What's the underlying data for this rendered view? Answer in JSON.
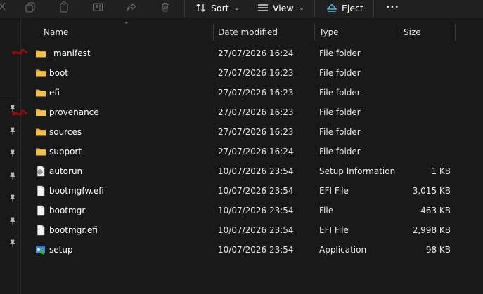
{
  "toolbar": {
    "sort_label": "Sort",
    "view_label": "View",
    "eject_label": "Eject",
    "more_label": "•••"
  },
  "columns": {
    "name": "Name",
    "date": "Date modified",
    "type": "Type",
    "size": "Size"
  },
  "files": [
    {
      "name": "_manifest",
      "date": "27/07/2026 16:24",
      "type": "File folder",
      "size": "",
      "icon": "folder-icon"
    },
    {
      "name": "boot",
      "date": "27/07/2026 16:23",
      "type": "File folder",
      "size": "",
      "icon": "folder-icon"
    },
    {
      "name": "efi",
      "date": "27/07/2026 16:23",
      "type": "File folder",
      "size": "",
      "icon": "folder-icon"
    },
    {
      "name": "provenance",
      "date": "27/07/2026 16:23",
      "type": "File folder",
      "size": "",
      "icon": "folder-icon"
    },
    {
      "name": "sources",
      "date": "27/07/2026 16:23",
      "type": "File folder",
      "size": "",
      "icon": "folder-icon"
    },
    {
      "name": "support",
      "date": "27/07/2026 16:24",
      "type": "File folder",
      "size": "",
      "icon": "folder-icon"
    },
    {
      "name": "autorun",
      "date": "10/07/2026 23:54",
      "type": "Setup Information",
      "size": "1 KB",
      "icon": "setup-info-icon"
    },
    {
      "name": "bootmgfw.efi",
      "date": "10/07/2026 23:54",
      "type": "EFI File",
      "size": "3,015 KB",
      "icon": "file-icon"
    },
    {
      "name": "bootmgr",
      "date": "10/07/2026 23:54",
      "type": "File",
      "size": "463 KB",
      "icon": "file-icon"
    },
    {
      "name": "bootmgr.efi",
      "date": "10/07/2026 23:54",
      "type": "EFI File",
      "size": "2,998 KB",
      "icon": "file-icon"
    },
    {
      "name": "setup",
      "date": "10/07/2026 23:54",
      "type": "Application",
      "size": "98 KB",
      "icon": "application-icon"
    }
  ],
  "colors": {
    "background": "#191919",
    "folder": "#f2c04c",
    "accent": "#60cdff"
  }
}
